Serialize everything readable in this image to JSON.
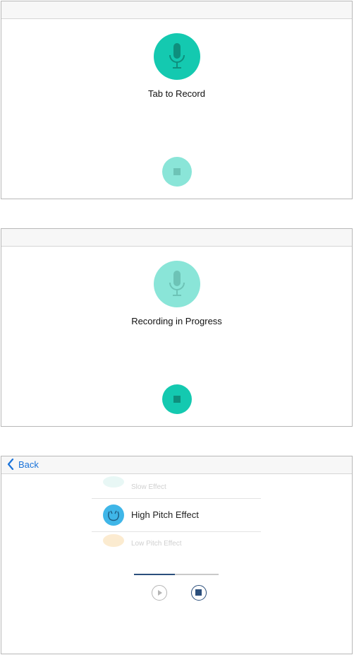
{
  "screen1": {
    "status_label": "Tab to Record",
    "mic_color": "#14c9b0",
    "stop_color": "#8ae5d8"
  },
  "screen2": {
    "status_label": "Recording in Progress",
    "mic_color": "#8ae5d8",
    "stop_color": "#14c9b0"
  },
  "screen3": {
    "back_label": "Back",
    "effects": [
      {
        "label": "Slow Effect",
        "icon": "wave-icon",
        "selected": false
      },
      {
        "label": "High Pitch Effect",
        "icon": "squirrel-icon",
        "selected": true
      },
      {
        "label": "Low Pitch Effect",
        "icon": "snail-icon",
        "selected": false
      }
    ],
    "playback_progress": 0.48,
    "accent_color": "#1a73d9"
  }
}
